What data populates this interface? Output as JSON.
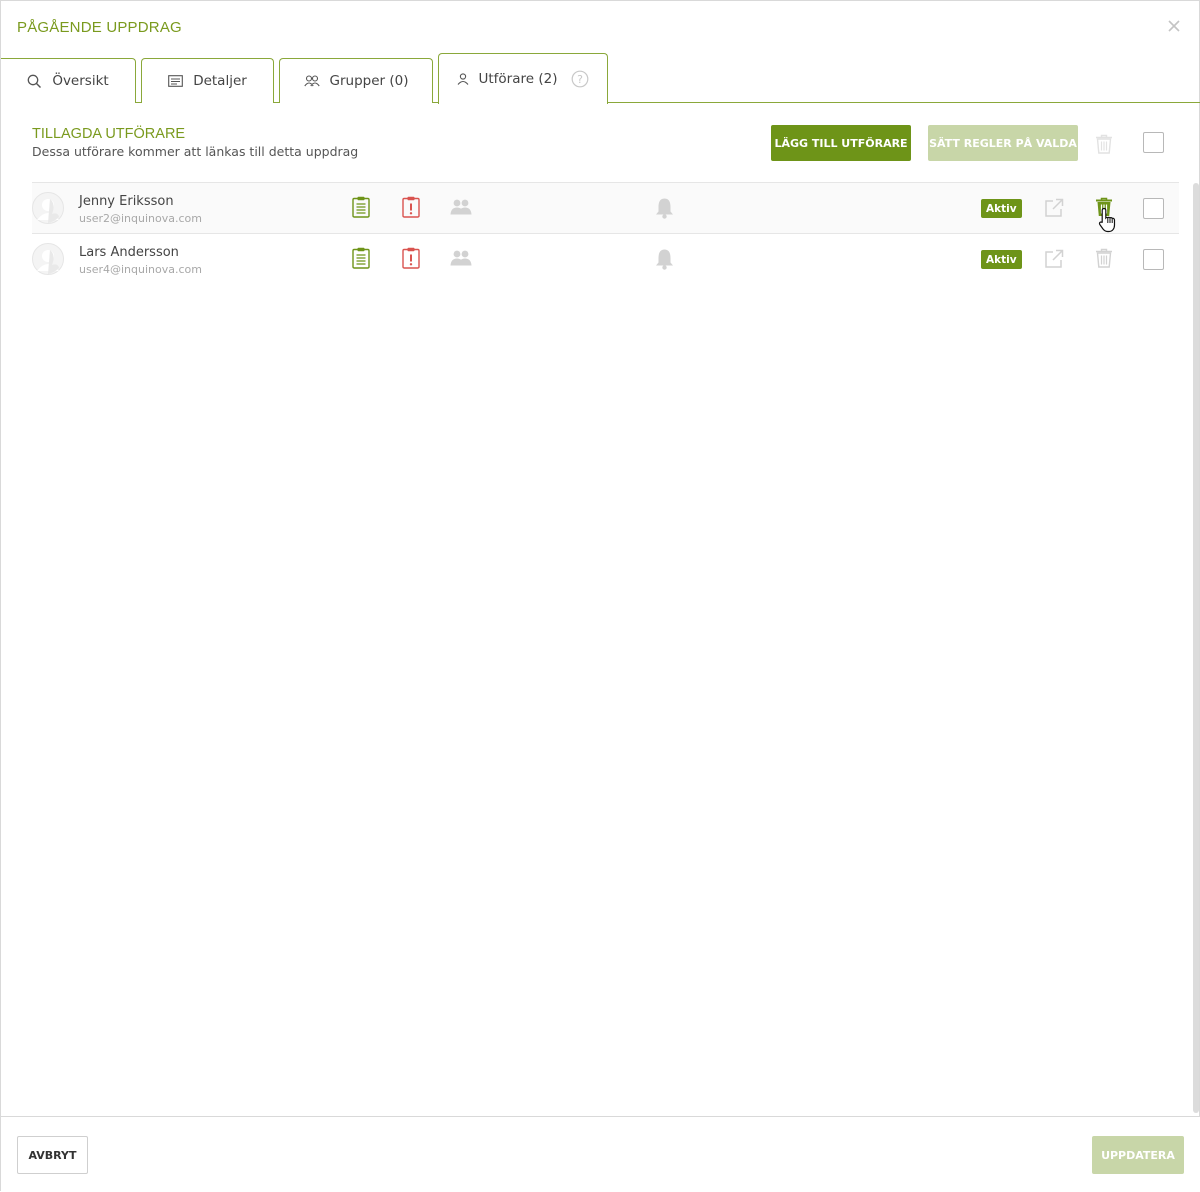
{
  "modal": {
    "title": "PÅGÅENDE UPPDRAG",
    "close_icon": "close-icon"
  },
  "tabs": [
    {
      "label": "Översikt",
      "icon": "search-icon"
    },
    {
      "label": "Detaljer",
      "icon": "list-icon"
    },
    {
      "label": "Grupper (0)",
      "icon": "users-icon"
    },
    {
      "label": "Utförare (2)",
      "icon": "user-icon",
      "active": true,
      "help_icon": "help-icon"
    }
  ],
  "section": {
    "title": "TILLAGDA UTFÖRARE",
    "subtitle": "Dessa utförare kommer att länkas till detta uppdrag",
    "add_button": "LÄGG TILL UTFÖRARE",
    "rules_button": "SÄTT REGLER PÅ VALDA"
  },
  "performers": [
    {
      "name": "Jenny Eriksson",
      "email": "user2@inquinova.com",
      "status": "Aktiv"
    },
    {
      "name": "Lars Andersson",
      "email": "user4@inquinova.com",
      "status": "Aktiv"
    }
  ],
  "footer": {
    "cancel": "AVBRYT",
    "update": "UPPDATERA"
  },
  "colors": {
    "accent": "#6e9418",
    "accent_light": "#c8d6a8",
    "title_green": "#7a9a1e",
    "danger": "#d9534f"
  }
}
